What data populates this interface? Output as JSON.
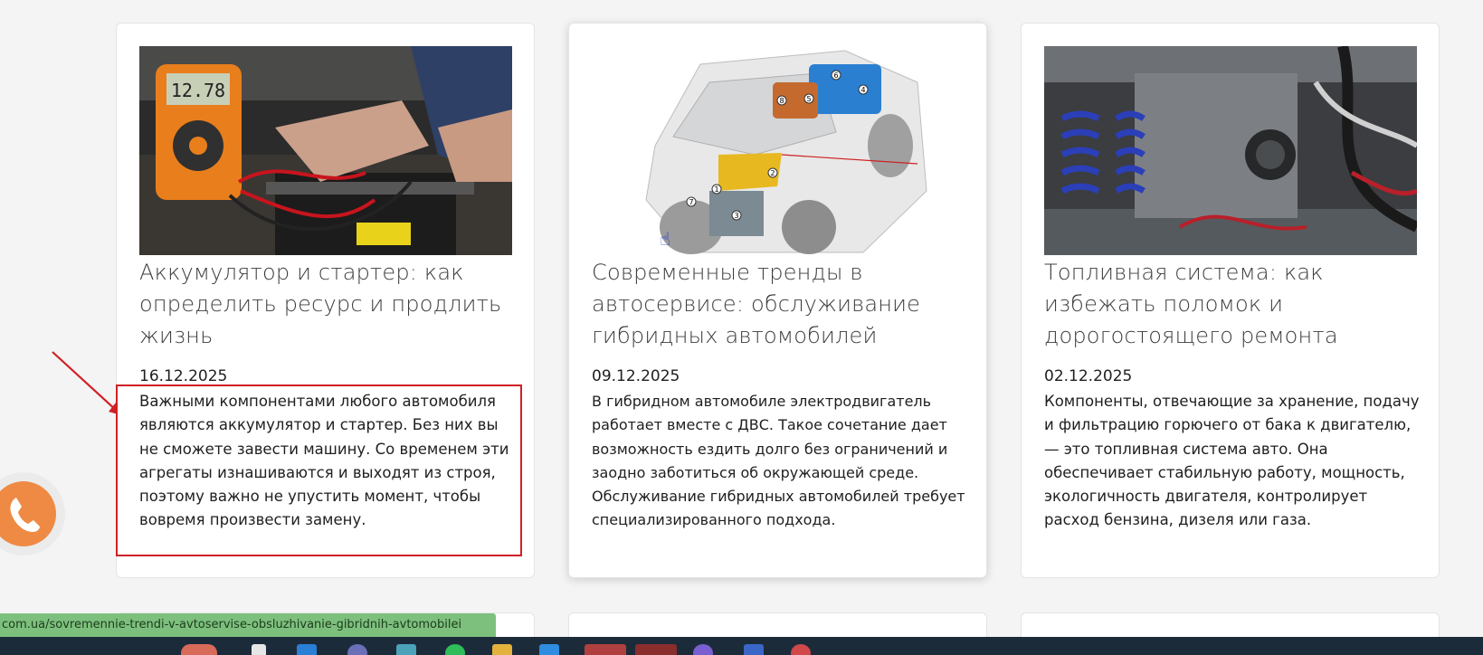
{
  "status_url": "com.ua/sovremennie-trendi-v-avtoservise-obsluzhivanie-gibridnih-avtomobilei",
  "colors": {
    "highlight": "#d01f26",
    "phone_button": "#ef8a44",
    "status_bar": "#7dc07d"
  },
  "articles": [
    {
      "title": "Аккумулятор и стартер: как определить ресурс и продлить жизнь",
      "date": "16.12.2025",
      "excerpt": "Важными компонентами любого автомобиля являются аккумулятор и стартер. Без них вы не сможете завести машину. Со временем эти агрегаты изнашиваются и выходят из строя, поэтому важно не упустить момент, чтобы вовремя произвести замену.",
      "image_meter_value": "12.78"
    },
    {
      "title": "Современные тренды в автосервисе: обслуживание гибридных автомобилей",
      "date": "09.12.2025",
      "excerpt": "В гибридном автомобиле электродвигатель работает вместе с ДВС. Такое сочетание дает возможность ездить долго без ограничений и заодно заботиться об окружающей среде. Обслуживание гибридных автомобилей требует специализированного подхода.",
      "image_callouts": [
        "1",
        "2",
        "3",
        "4",
        "5",
        "6",
        "7",
        "8"
      ]
    },
    {
      "title": "Топливная система: как избежать поломок и дорогостоящего ремонта",
      "date": "02.12.2025",
      "excerpt": "Компоненты, отвечающие за хранение, подачу и фильтрацию горючего от бака к двигателю, — это топливная система авто. Она обеспечивает стабильную работу, мощность, экологичность двигателя, контролирует расход бензина, дизеля или газа."
    }
  ]
}
